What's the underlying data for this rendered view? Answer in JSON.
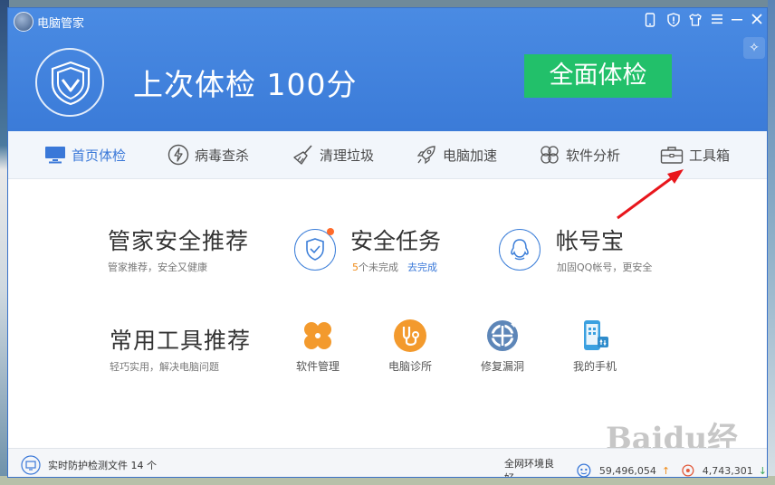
{
  "app": {
    "title": "电脑管家"
  },
  "header": {
    "score_text": "上次体检 100分",
    "exam_button": "全面体检"
  },
  "nav": [
    {
      "label": "首页体检",
      "icon": "monitor-icon",
      "active": true
    },
    {
      "label": "病毒查杀",
      "icon": "lightning-icon"
    },
    {
      "label": "清理垃圾",
      "icon": "broom-icon"
    },
    {
      "label": "电脑加速",
      "icon": "rocket-icon"
    },
    {
      "label": "软件分析",
      "icon": "clover-icon"
    },
    {
      "label": "工具箱",
      "icon": "toolbox-icon"
    }
  ],
  "recommend": {
    "title": "管家安全推荐",
    "subtitle": "管家推荐，安全又健康",
    "task_title": "安全任务",
    "task_count": "5",
    "task_suffix": "个未完成",
    "task_link": "去完成",
    "account_title": "帐号宝",
    "account_sub": "加固QQ帐号，更安全"
  },
  "tools": {
    "title": "常用工具推荐",
    "subtitle": "轻巧实用，解决电脑问题",
    "items": [
      {
        "label": "软件管理",
        "icon": "software-manager-icon"
      },
      {
        "label": "电脑诊所",
        "icon": "pc-clinic-icon"
      },
      {
        "label": "修复漏洞",
        "icon": "repair-icon"
      },
      {
        "label": "我的手机",
        "icon": "my-phone-icon"
      }
    ]
  },
  "status": {
    "protect_text": "实时防护检测文件 14 个",
    "network_text": "全网环境良好",
    "count_a": "59,496,054",
    "count_b": "4,743,301"
  },
  "watermark": "Baidu经验",
  "colors": {
    "header": "#3b7bd8",
    "exam_button": "#22c06a",
    "accent": "#3a78d8",
    "arrow": "#e8161c"
  }
}
